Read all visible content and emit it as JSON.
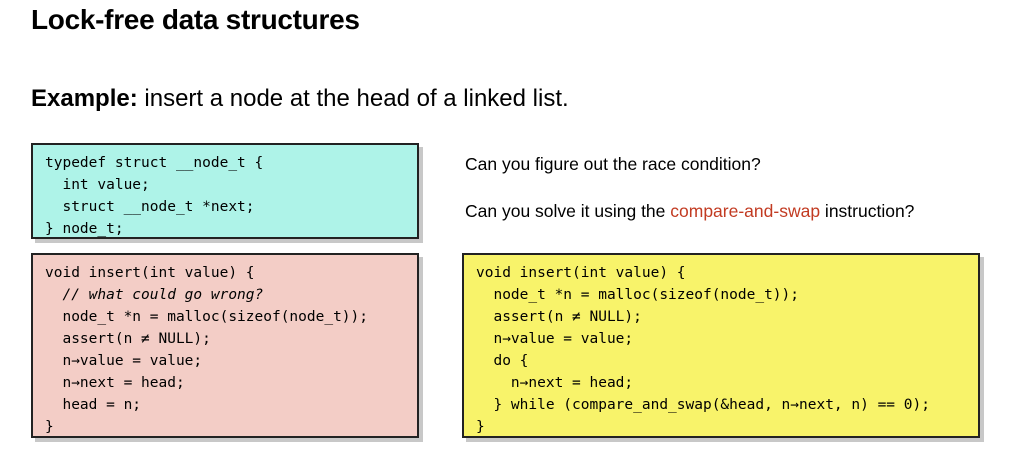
{
  "header": {
    "title": "Lock-free data structures"
  },
  "example": {
    "label": "Example:",
    "text": " insert a node at the head of a linked list."
  },
  "struct_code": {
    "lines": [
      "typedef struct __node_t {",
      "  int value;",
      "  struct __node_t *next;",
      "} node_t;"
    ]
  },
  "race_code": {
    "lines": [
      "void insert(int value) {",
      "  // what could go wrong?",
      "  node_t *n = malloc(sizeof(node_t));",
      "  assert(n ≠ NULL);",
      "  n→value = value;",
      "  n→next = head;",
      "  head = n;",
      "}"
    ]
  },
  "cas_code": {
    "lines": [
      "void insert(int value) {",
      "  node_t *n = malloc(sizeof(node_t));",
      "  assert(n ≠ NULL);",
      "  n→value = value;",
      "  do {",
      "    n→next = head;",
      "  } while (compare_and_swap(&head, n→next, n) == 0);",
      "}"
    ]
  },
  "questions": {
    "q1": "Can you figure out the race condition?",
    "q2_prefix": "Can you solve it using the ",
    "q2_accent": "compare-and-swap",
    "q2_suffix": " instruction?"
  },
  "colors": {
    "struct_box": "#aef3e8",
    "race_box": "#f3cdc6",
    "cas_box": "#f8f36a",
    "accent": "#c23b22"
  }
}
